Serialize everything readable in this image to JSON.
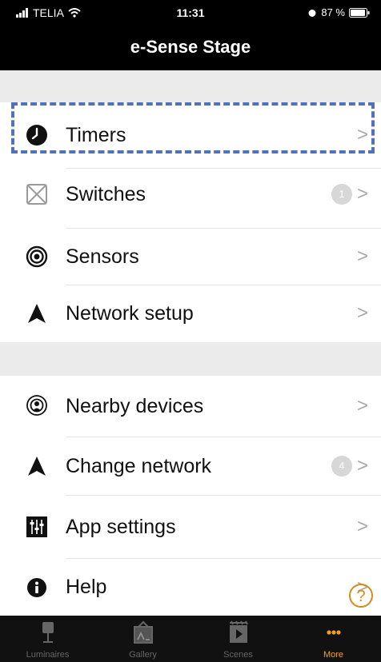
{
  "status_bar": {
    "carrier": "TELIA",
    "time": "11:31",
    "battery": "87 %"
  },
  "nav": {
    "title": "e-Sense Stage"
  },
  "menu": {
    "timers": {
      "label": "Timers",
      "icon": "clock-icon"
    },
    "switches": {
      "label": "Switches",
      "icon": "switch-icon",
      "badge": "1"
    },
    "sensors": {
      "label": "Sensors",
      "icon": "sensor-icon"
    },
    "network_setup": {
      "label": "Network setup",
      "icon": "network-arrow-icon"
    },
    "nearby_devices": {
      "label": "Nearby devices",
      "icon": "nearby-devices-icon"
    },
    "change_network": {
      "label": "Change network",
      "icon": "network-arrow-icon",
      "badge": "4"
    },
    "app_settings": {
      "label": "App settings",
      "icon": "sliders-icon"
    },
    "help": {
      "label": "Help",
      "icon": "info-icon"
    }
  },
  "chevron": ">",
  "help_fab": "?",
  "tabs": {
    "luminaires": "Luminaires",
    "gallery": "Gallery",
    "scenes": "Scenes",
    "more": "More"
  },
  "colors": {
    "accent": "#f0a020",
    "focus": "#4f72b8",
    "section_bg": "#ebebeb"
  }
}
